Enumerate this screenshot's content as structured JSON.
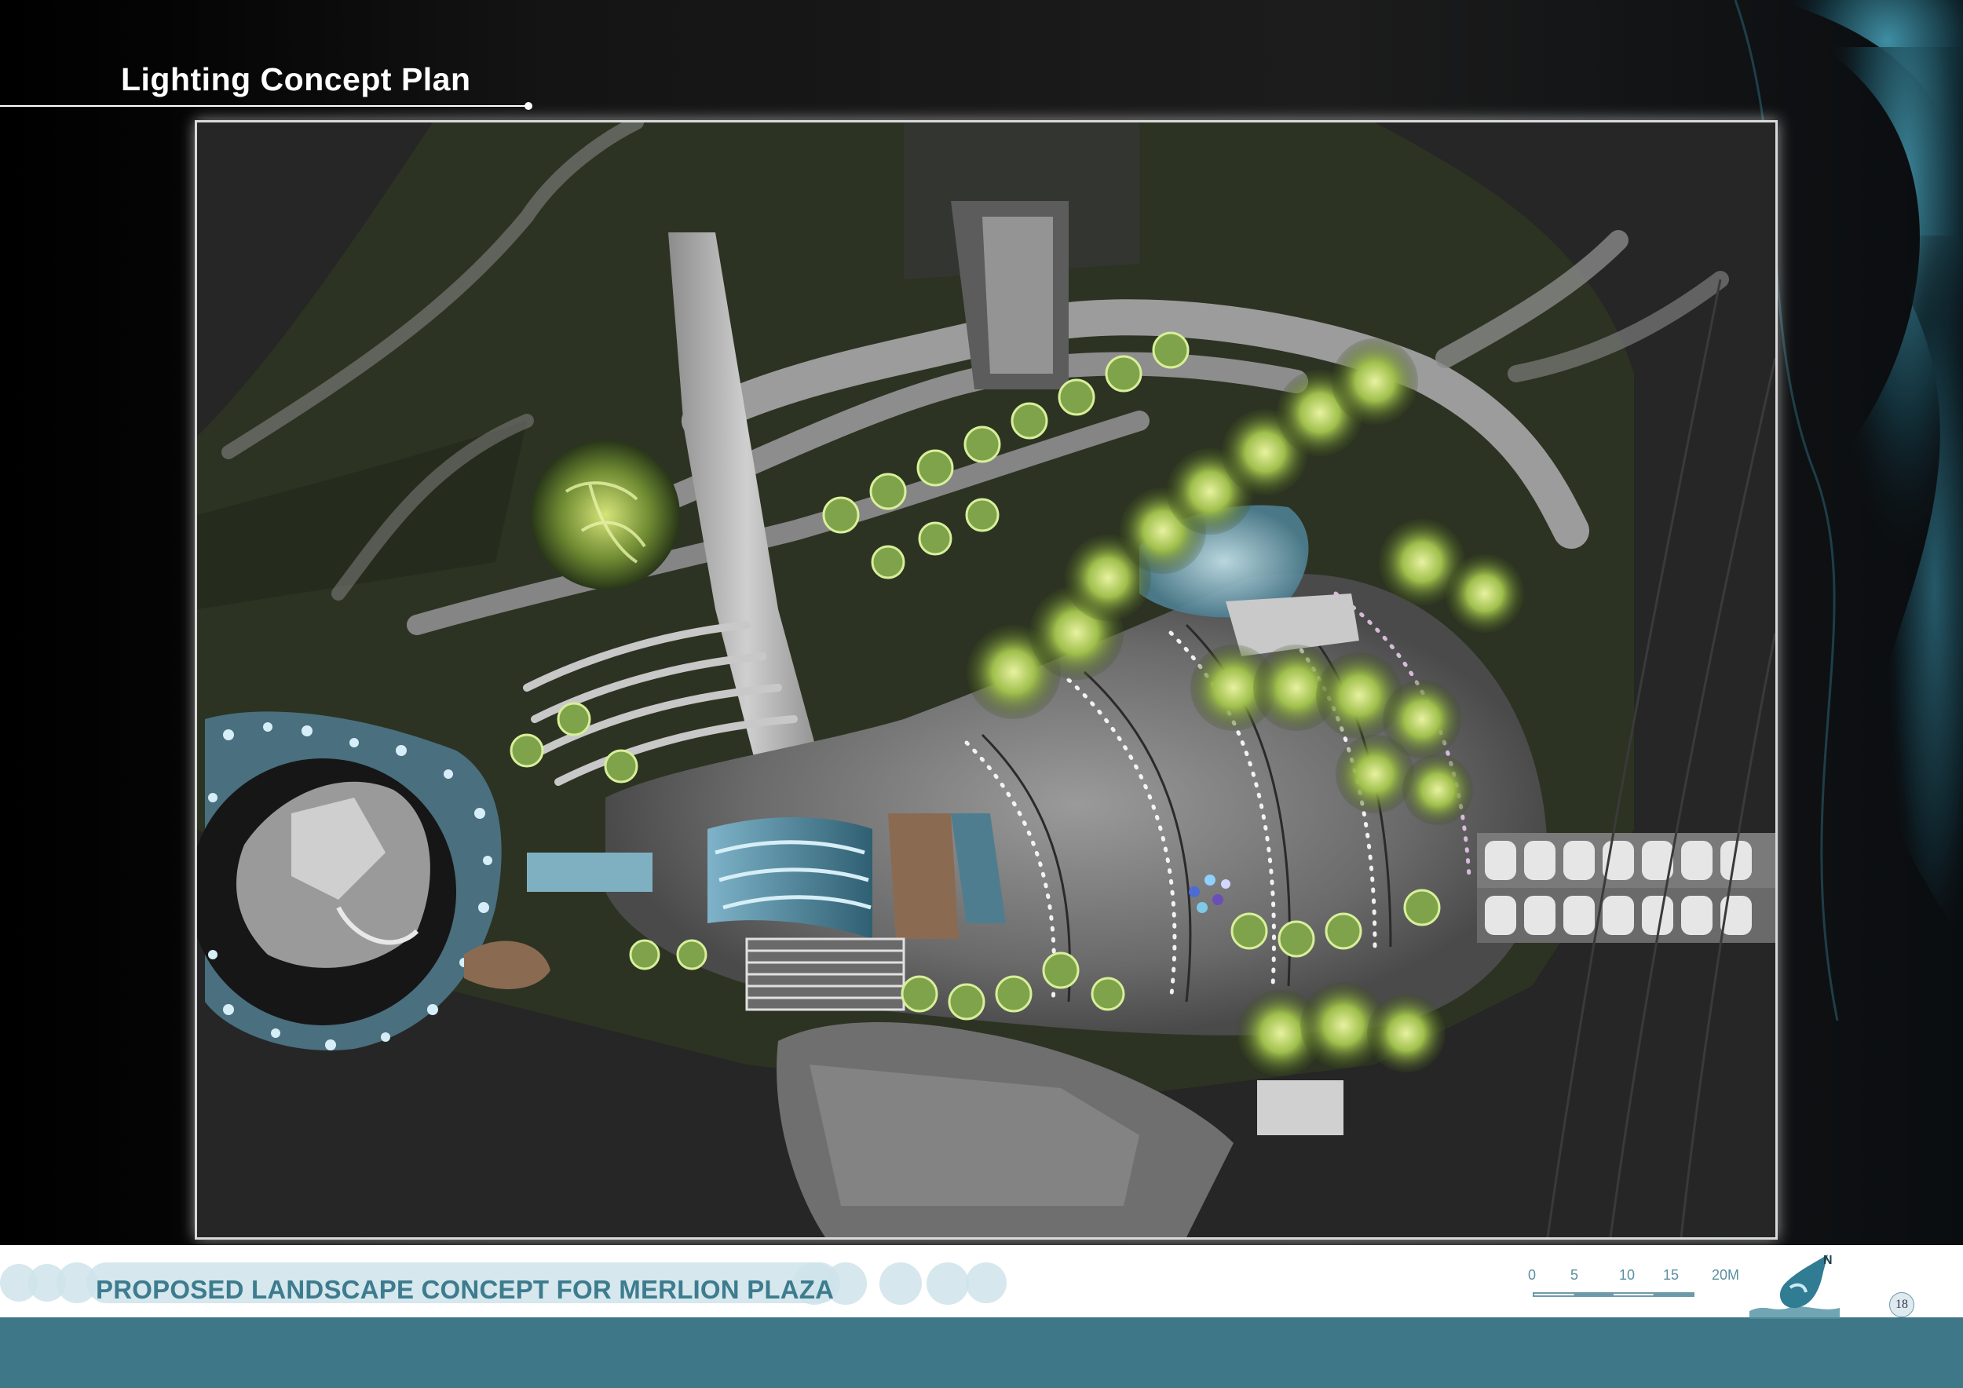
{
  "header": {
    "title": "Lighting Concept Plan"
  },
  "footer": {
    "project_title": "PROPOSED LANDSCAPE CONCEPT FOR MERLION PLAZA",
    "scale_labels": [
      "0",
      "5",
      "10",
      "15",
      "20M"
    ],
    "north_label": "N",
    "page_number": "18"
  },
  "colors": {
    "footer_band": "#3e7788",
    "footer_text": "#3c7c8e",
    "title_text": "#ffffff",
    "water_light": "#9fd3e6",
    "tree_glow": "#b7d66a"
  },
  "icons": {
    "north_arrow": "water-drop-north-arrow-icon",
    "page_badge": "circle-page-badge-icon"
  }
}
